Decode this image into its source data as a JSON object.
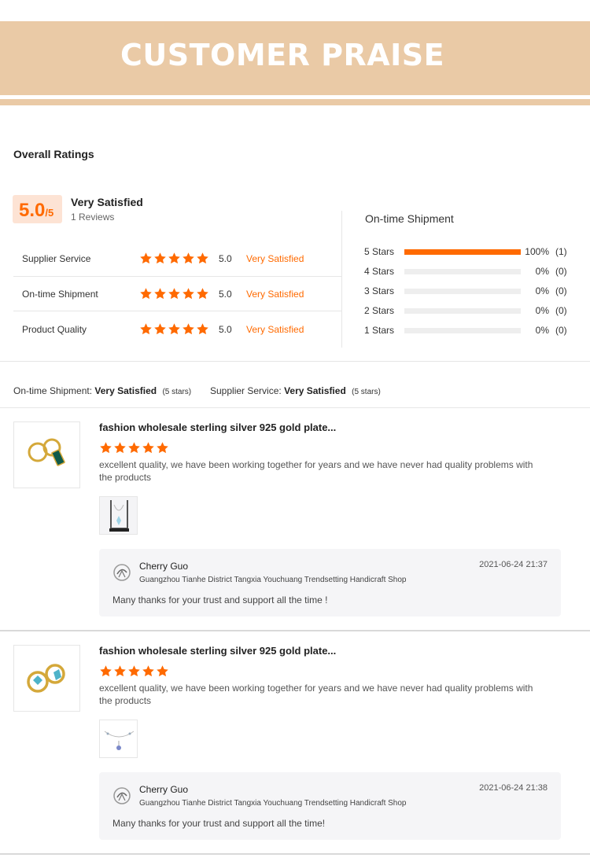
{
  "banner": {
    "title": "CUSTOMER PRAISE"
  },
  "overall": {
    "title": "Overall Ratings",
    "score": "5.0",
    "score_max": "/5",
    "label": "Very Satisfied",
    "reviews": "1 Reviews",
    "rows": [
      {
        "label": "Supplier Service",
        "stars": 5,
        "value": "5.0",
        "desc": "Very Satisfied"
      },
      {
        "label": "On-time Shipment",
        "stars": 5,
        "value": "5.0",
        "desc": "Very Satisfied"
      },
      {
        "label": "Product Quality",
        "stars": 5,
        "value": "5.0",
        "desc": "Very Satisfied"
      }
    ]
  },
  "shipment": {
    "title": "On-time Shipment",
    "rows": [
      {
        "label": "5  Stars",
        "fraction": 1.0,
        "pct": "100%",
        "count": "(1)"
      },
      {
        "label": "4  Stars",
        "fraction": 0,
        "pct": "0%",
        "count": "(0)"
      },
      {
        "label": "3  Stars",
        "fraction": 0,
        "pct": "0%",
        "count": "(0)"
      },
      {
        "label": "2  Stars",
        "fraction": 0,
        "pct": "0%",
        "count": "(0)"
      },
      {
        "label": "1  Stars",
        "fraction": 0,
        "pct": "0%",
        "count": "(0)"
      }
    ]
  },
  "summary": {
    "shipment_label": "On-time Shipment:",
    "shipment_value": "Very Satisfied",
    "shipment_stars": "(5 stars)",
    "supplier_label": "Supplier Service:",
    "supplier_value": "Very Satisfied",
    "supplier_stars": "(5 stars)"
  },
  "reviews": [
    {
      "title": "fashion wholesale sterling silver 925 gold plate...",
      "stars": 5,
      "text": "excellent quality, we have been working together for years and we have never had quality problems with the products",
      "reply": {
        "name": "Cherry Guo",
        "shop": "Guangzhou Tianhe District Tangxia Youchuang Trendsetting Handicraft Shop",
        "date": "2021-06-24 21:37",
        "message": "Many thanks for your trust and support all the time !"
      }
    },
    {
      "title": "fashion wholesale sterling silver 925 gold plate...",
      "stars": 5,
      "text": "excellent quality, we have been working together for years and we have never had quality problems with the products",
      "reply": {
        "name": "Cherry Guo",
        "shop": "Guangzhou Tianhe District Tangxia Youchuang Trendsetting Handicraft Shop",
        "date": "2021-06-24 21:38",
        "message": "Many thanks for your trust and support all the time!"
      }
    }
  ],
  "colors": {
    "accent": "#ff6a00",
    "banner": "#eacaa6",
    "score_bg": "#fde3d4"
  }
}
